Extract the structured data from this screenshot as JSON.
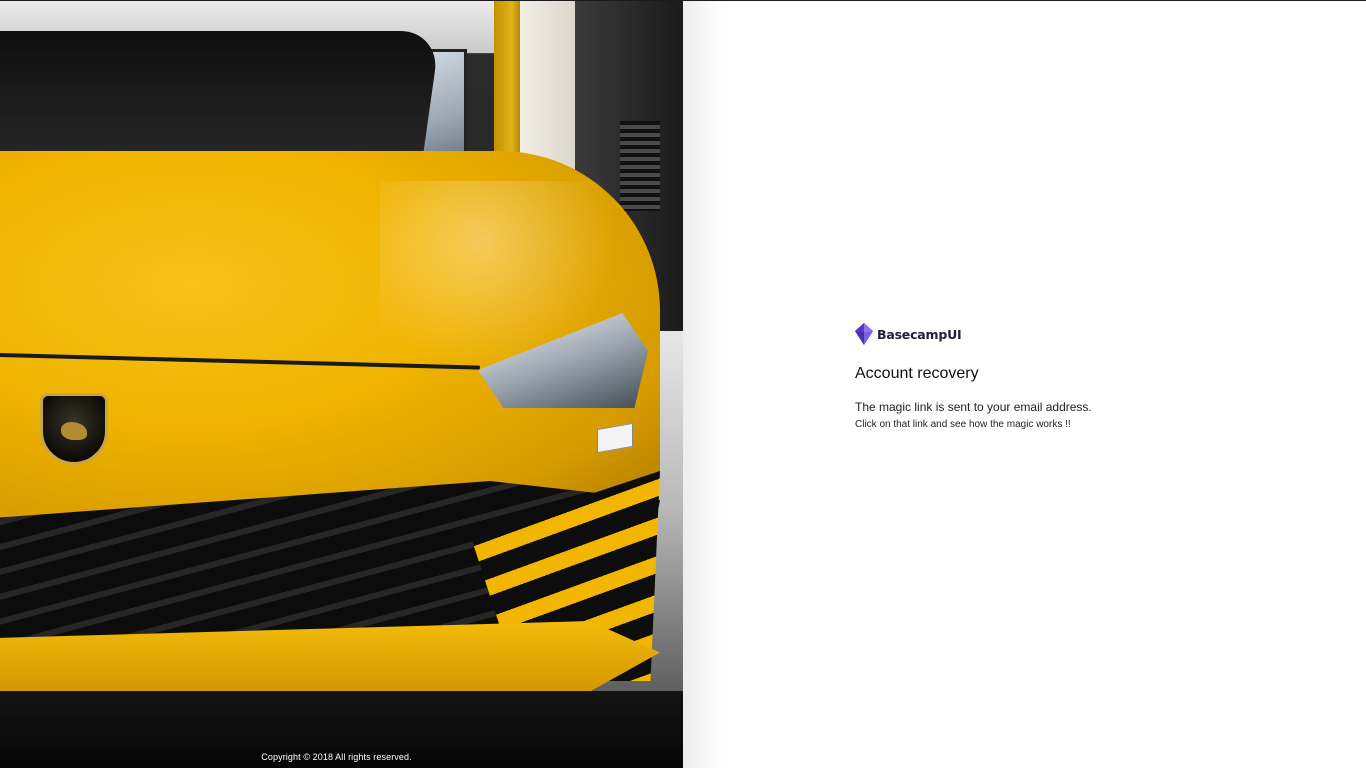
{
  "hero": {
    "image_alt": "yellow-sports-car-photo",
    "copyright": "Copyright © 2018 All rights reserved."
  },
  "brand": {
    "logo_icon": "purple-gem-icon",
    "name": "BasecampUI",
    "logo_color": "#6c4ce0"
  },
  "recovery": {
    "title": "Account recovery",
    "message_line1": "The magic link is sent to your email address.",
    "message_line2": "Click on that link and see how the magic works !!"
  }
}
